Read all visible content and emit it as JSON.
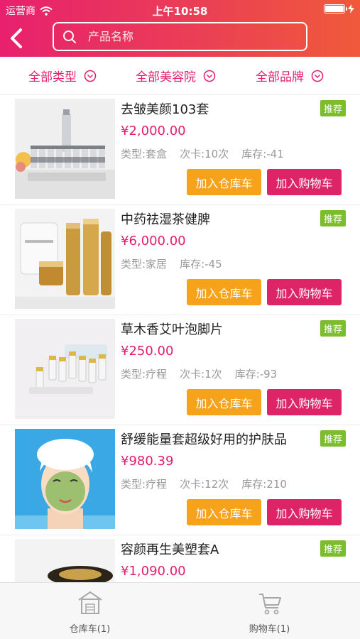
{
  "status_bar": {
    "carrier": "运营商",
    "time": "上午10:58"
  },
  "search": {
    "placeholder": "产品名称"
  },
  "filters": [
    {
      "label": "全部类型"
    },
    {
      "label": "全部美容院"
    },
    {
      "label": "全部品牌"
    }
  ],
  "products": [
    {
      "name": "去皱美颜103套",
      "price": "¥2,000.00",
      "type": "类型:套盒",
      "card": "次卡:10次",
      "stock": "库存:-41",
      "tag": "推荐"
    },
    {
      "name": "中药祛湿茶健脾",
      "price": "¥6,000.00",
      "type": "类型:家居",
      "stock": "库存:-45",
      "tag": "推荐"
    },
    {
      "name": "草木香艾叶泡脚片",
      "price": "¥250.00",
      "type": "类型:疗程",
      "card": "次卡:1次",
      "stock": "库存:-93",
      "tag": "推荐"
    },
    {
      "name": "舒缓能量套超级好用的护肤品",
      "price": "¥980.39",
      "type": "类型:疗程",
      "card": "次卡:12次",
      "stock": "库存:210",
      "tag": "推荐"
    },
    {
      "name": "容颜再生美塑套A",
      "price": "¥1,090.00",
      "tag": "推荐"
    }
  ],
  "buttons": {
    "add_warehouse": "加入仓库车",
    "add_cart": "加入购物车"
  },
  "tabbar": {
    "warehouse": "仓库车(1)",
    "cart": "购物车(1)"
  },
  "colors": {
    "accent": "#e31e6f",
    "warehouse_button": "#f7a21b",
    "cart_button": "#dc2466",
    "recommend_tag": "#7cbd2e"
  }
}
